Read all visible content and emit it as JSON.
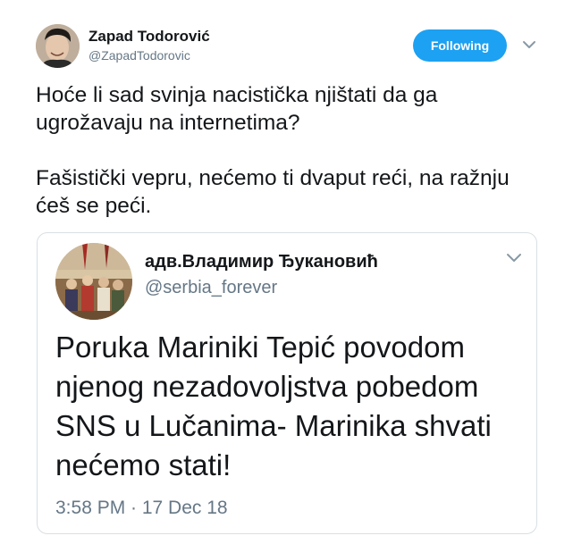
{
  "tweet": {
    "author": {
      "name": "Zapad Todorović",
      "handle": "@ZapadTodorovic"
    },
    "follow_label": "Following",
    "text": "Hoće li sad svinja nacistička njištati da ga ugrožavaju na internetima?\n\nFašistički vepru, nećemo ti dvaput reći, na ražnju ćeš se peći."
  },
  "quoted": {
    "author": {
      "name": "адв.Владимир Ђукановић",
      "handle": "@serbia_forever"
    },
    "text": "Poruka Mariniki Tepić povodom njenog nezadovoljstva pobedom SNS u Lučanima- Marinika shvati nećemo stati!",
    "timestamp": "3:58 PM · 17 Dec 18"
  },
  "colors": {
    "accent": "#1da1f2",
    "secondary_text": "#657786",
    "border": "#d8dfe4"
  },
  "icons": {
    "menu_caret": "chevron-down-icon"
  }
}
